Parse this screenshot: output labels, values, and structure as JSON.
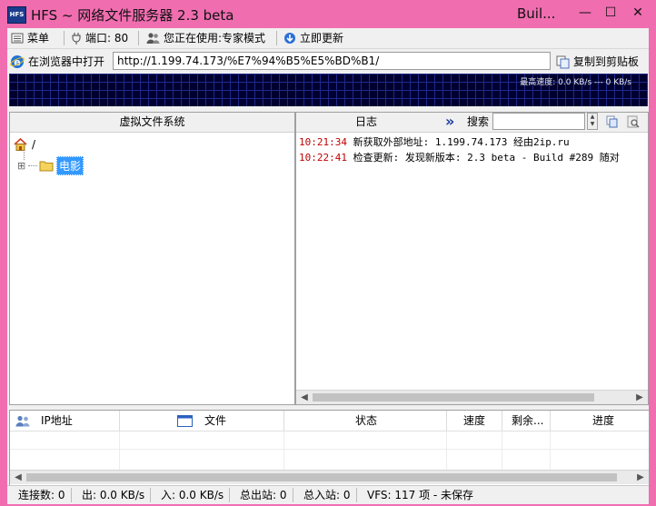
{
  "window": {
    "app_icon_text": "HFS",
    "title": "HFS ~ 网络文件服务器 2.3 beta",
    "title_right": "Buil...",
    "minimize": "—",
    "maximize": "☐",
    "close": "✕"
  },
  "toolbar": {
    "menu_label": "菜单",
    "port_label": "端口: 80",
    "mode_label": "您正在使用:专家模式",
    "update_label": "立即更新"
  },
  "urlbar": {
    "open_label": "在浏览器中打开",
    "url_value": "http://1.199.74.173/%E7%94%B5%E5%BD%B1/",
    "copy_label": "复制到剪贴板"
  },
  "graph": {
    "speed_text": "最高速度: 0.0 KB/s --- 0 KB/s"
  },
  "vfs": {
    "header": "虚拟文件系统",
    "root_label": "/",
    "expander": "⊞",
    "folder_label": "电影"
  },
  "log": {
    "header": "日志",
    "expand_glyph": "»",
    "search_label": "搜索",
    "search_value": "",
    "lines": [
      {
        "time": "10:21:34",
        "text": " 新获取外部地址: 1.199.74.173 经由2ip.ru"
      },
      {
        "time": "10:22:41",
        "text": " 检查更新: 发现新版本: 2.3 beta - Build #289 随对"
      }
    ]
  },
  "connections": {
    "columns": [
      "IP地址",
      "文件",
      "状态",
      "速度",
      "剩余...",
      "进度"
    ]
  },
  "statusbar": {
    "connections": "连接数: 0",
    "out_speed": "出: 0.0 KB/s",
    "in_speed": "入: 0.0 KB/s",
    "total_out": "总出站: 0",
    "total_in": "总入站: 0",
    "vfs_info": "VFS: 117 项 - 未保存"
  },
  "colors": {
    "window_frame": "#f06db0",
    "graph_background": "#000030",
    "log_time": "#c00000",
    "selection": "#3399ff"
  }
}
